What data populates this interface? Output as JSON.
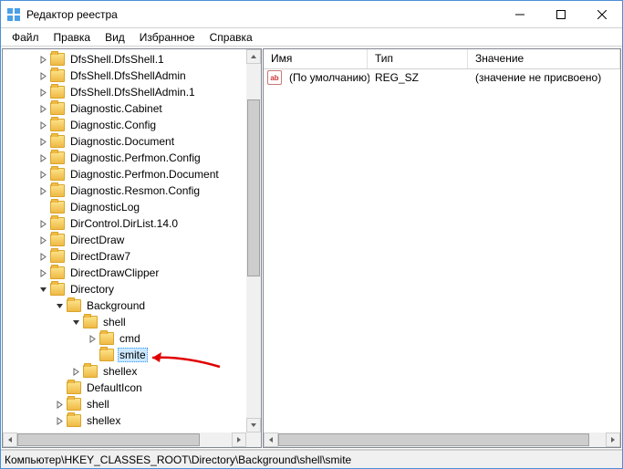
{
  "window": {
    "title": "Редактор реестра"
  },
  "menu": {
    "file": "Файл",
    "edit": "Правка",
    "view": "Вид",
    "fav": "Избранное",
    "help": "Справка"
  },
  "tree": {
    "items": [
      {
        "indent": 2,
        "tw": "right",
        "label": "DfsShell.DfsShell.1"
      },
      {
        "indent": 2,
        "tw": "right",
        "label": "DfsShell.DfsShellAdmin"
      },
      {
        "indent": 2,
        "tw": "right",
        "label": "DfsShell.DfsShellAdmin.1"
      },
      {
        "indent": 2,
        "tw": "right",
        "label": "Diagnostic.Cabinet"
      },
      {
        "indent": 2,
        "tw": "right",
        "label": "Diagnostic.Config"
      },
      {
        "indent": 2,
        "tw": "right",
        "label": "Diagnostic.Document"
      },
      {
        "indent": 2,
        "tw": "right",
        "label": "Diagnostic.Perfmon.Config"
      },
      {
        "indent": 2,
        "tw": "right",
        "label": "Diagnostic.Perfmon.Document"
      },
      {
        "indent": 2,
        "tw": "right",
        "label": "Diagnostic.Resmon.Config"
      },
      {
        "indent": 2,
        "tw": "none",
        "label": "DiagnosticLog"
      },
      {
        "indent": 2,
        "tw": "right",
        "label": "DirControl.DirList.14.0"
      },
      {
        "indent": 2,
        "tw": "right",
        "label": "DirectDraw"
      },
      {
        "indent": 2,
        "tw": "right",
        "label": "DirectDraw7"
      },
      {
        "indent": 2,
        "tw": "right",
        "label": "DirectDrawClipper"
      },
      {
        "indent": 2,
        "tw": "down",
        "label": "Directory"
      },
      {
        "indent": 3,
        "tw": "down",
        "label": "Background"
      },
      {
        "indent": 4,
        "tw": "down",
        "label": "shell"
      },
      {
        "indent": 5,
        "tw": "right",
        "label": "cmd"
      },
      {
        "indent": 5,
        "tw": "none",
        "label": "smite",
        "sel": true
      },
      {
        "indent": 4,
        "tw": "right",
        "label": "shellex"
      },
      {
        "indent": 3,
        "tw": "none",
        "label": "DefaultIcon"
      },
      {
        "indent": 3,
        "tw": "right",
        "label": "shell"
      },
      {
        "indent": 3,
        "tw": "right",
        "label": "shellex"
      }
    ]
  },
  "columns": {
    "name": "Имя",
    "type": "Тип",
    "value": "Значение"
  },
  "rows": [
    {
      "name": "(По умолчанию)",
      "type": "REG_SZ",
      "value": "(значение не присвоено)"
    }
  ],
  "status": {
    "path": "Компьютер\\HKEY_CLASSES_ROOT\\Directory\\Background\\shell\\smite"
  }
}
